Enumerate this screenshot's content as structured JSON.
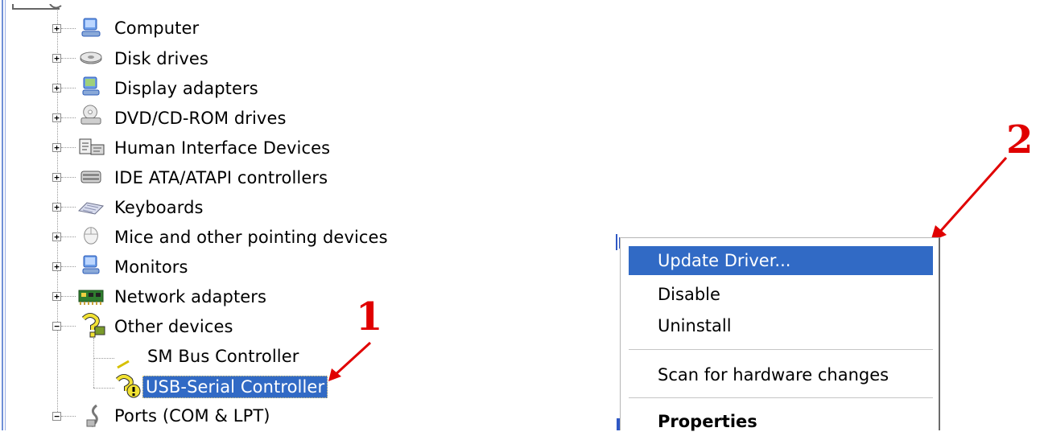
{
  "device_tree": {
    "items": [
      {
        "label": "Computer",
        "icon": "computer-icon",
        "expander": "+"
      },
      {
        "label": "Disk drives",
        "icon": "disk-drive-icon",
        "expander": "+"
      },
      {
        "label": "Display adapters",
        "icon": "display-adapter-icon",
        "expander": "+"
      },
      {
        "label": "DVD/CD-ROM drives",
        "icon": "dvd-drive-icon",
        "expander": "+"
      },
      {
        "label": "Human Interface Devices",
        "icon": "hid-icon",
        "expander": "+"
      },
      {
        "label": "IDE ATA/ATAPI controllers",
        "icon": "ide-controller-icon",
        "expander": "+"
      },
      {
        "label": "Keyboards",
        "icon": "keyboard-icon",
        "expander": "+"
      },
      {
        "label": "Mice and other pointing devices",
        "icon": "mouse-icon",
        "expander": "+"
      },
      {
        "label": "Monitors",
        "icon": "monitor-icon",
        "expander": "+"
      },
      {
        "label": "Network adapters",
        "icon": "network-adapter-icon",
        "expander": "+"
      },
      {
        "label": "Other devices",
        "icon": "unknown-device-icon",
        "expander": "−"
      },
      {
        "label": "SM Bus Controller",
        "icon": "warning-device-icon"
      },
      {
        "label": "USB-Serial Controller",
        "icon": "warning-device-icon",
        "selected": true
      },
      {
        "label": "Ports (COM & LPT)",
        "icon": "port-icon",
        "expander": "−"
      }
    ]
  },
  "context_menu": {
    "items": [
      {
        "label": "Update Driver...",
        "highlighted": true
      },
      {
        "label": "Disable"
      },
      {
        "label": "Uninstall"
      },
      {
        "label": "Scan for hardware changes"
      },
      {
        "label": "Properties",
        "bold": true
      }
    ]
  },
  "annotations": {
    "step1": "1",
    "step2": "2",
    "arrow_color": "#e00000"
  },
  "colors": {
    "selection": "#316ac5",
    "annotation": "#e00000"
  }
}
